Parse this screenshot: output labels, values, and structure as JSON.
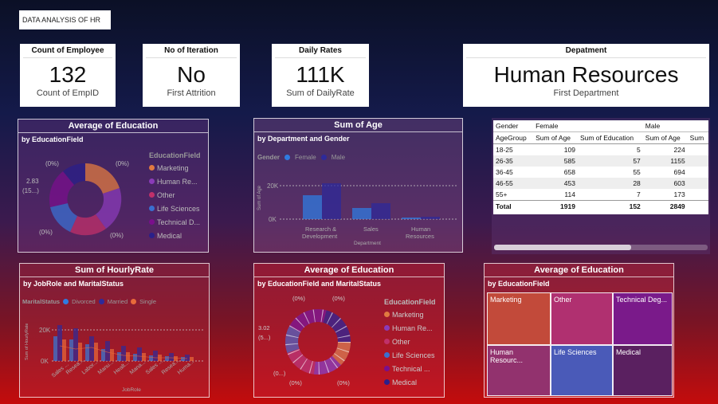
{
  "header": {
    "title": "DATA ANALYSIS OF HR"
  },
  "cards": [
    {
      "label": "Count of Employee",
      "value": "132",
      "sub": "Count of EmpID"
    },
    {
      "label": "No of Iteration",
      "value": "No",
      "sub": "First Attrition"
    },
    {
      "label": "Daily Rates",
      "value": "111K",
      "sub": "Sum of DailyRate"
    },
    {
      "label": "Depatment",
      "value": "Human Resources",
      "sub": "First Department"
    }
  ],
  "donut1": {
    "title": "Average of Education",
    "subtitle": "by EducationField",
    "legend_title": "EducationField",
    "legend": [
      "Marketing",
      "Human Re...",
      "Other",
      "Life Sciences",
      "Technical D...",
      "Medical"
    ],
    "labels": [
      "(0%)",
      "(0%)",
      "2.83",
      "(15...)",
      "(0%)",
      "(0%)"
    ]
  },
  "bar_age": {
    "title": "Sum of Age",
    "subtitle": "by Department and Gender",
    "legend_title": "Gender",
    "legend": [
      "Female",
      "Male"
    ],
    "yticks": [
      "20K",
      "0K"
    ],
    "ylabel": "Sum of Age",
    "xlabel": "Department",
    "xcats": [
      "Research &",
      "Development",
      "Sales",
      "Human",
      "Resources"
    ]
  },
  "matrix": {
    "header1": [
      "Gender",
      "Female",
      "",
      "Male",
      ""
    ],
    "header2": [
      "AgeGroup",
      "Sum of Age",
      "Sum of Education",
      "Sum of Age",
      "Sum"
    ],
    "rows": [
      [
        "18-25",
        "109",
        "5",
        "224"
      ],
      [
        "26-35",
        "585",
        "57",
        "1155"
      ],
      [
        "36-45",
        "658",
        "55",
        "694"
      ],
      [
        "46-55",
        "453",
        "28",
        "603"
      ],
      [
        "55+",
        "114",
        "7",
        "173"
      ]
    ],
    "total": [
      "Total",
      "1919",
      "152",
      "2849"
    ]
  },
  "hourly": {
    "title": "Sum of HourlyRate",
    "subtitle": "by JobRole and MaritalStatus",
    "legend_title": "MaritalStatus",
    "legend": [
      "Divorced",
      "Married",
      "Single"
    ],
    "yticks": [
      "20K",
      "0K"
    ],
    "ylabel": "Sum of HourlyRate",
    "xlabel": "JobRole",
    "xcats": [
      "Sales ...",
      "Resea...",
      "Labor...",
      "Manu...",
      "Healt...",
      "Mana...",
      "Sales ...",
      "Resea...",
      "Huma..."
    ]
  },
  "donut2": {
    "title": "Average of Education",
    "subtitle": "by EducationField and MaritalStatus",
    "legend_title": "EducationField",
    "legend": [
      "Marketing",
      "Human Re...",
      "Other",
      "Life Sciences",
      "Technical ...",
      "Medical"
    ],
    "labels": [
      "(0%)",
      "(0%)",
      "3.02",
      "(5...)",
      "(0...)",
      "(0%)",
      "(0%)"
    ]
  },
  "treemap": {
    "title": "Average of Education",
    "subtitle": "by EducationField",
    "cells": [
      "Marketing",
      "Other",
      "Technical Deg...",
      "Human Resourc...",
      "Life Sciences",
      "Medical"
    ]
  },
  "colors": {
    "marketing": "#e07a40",
    "human_resources": "#8a3bb8",
    "other": "#c0306a",
    "life_sciences": "#3a6fd0",
    "technical": "#7a0f8c",
    "medical": "#2a1f8a",
    "female": "#2f7be0",
    "male": "#2e2a9a",
    "single": "#e86a3a"
  }
}
